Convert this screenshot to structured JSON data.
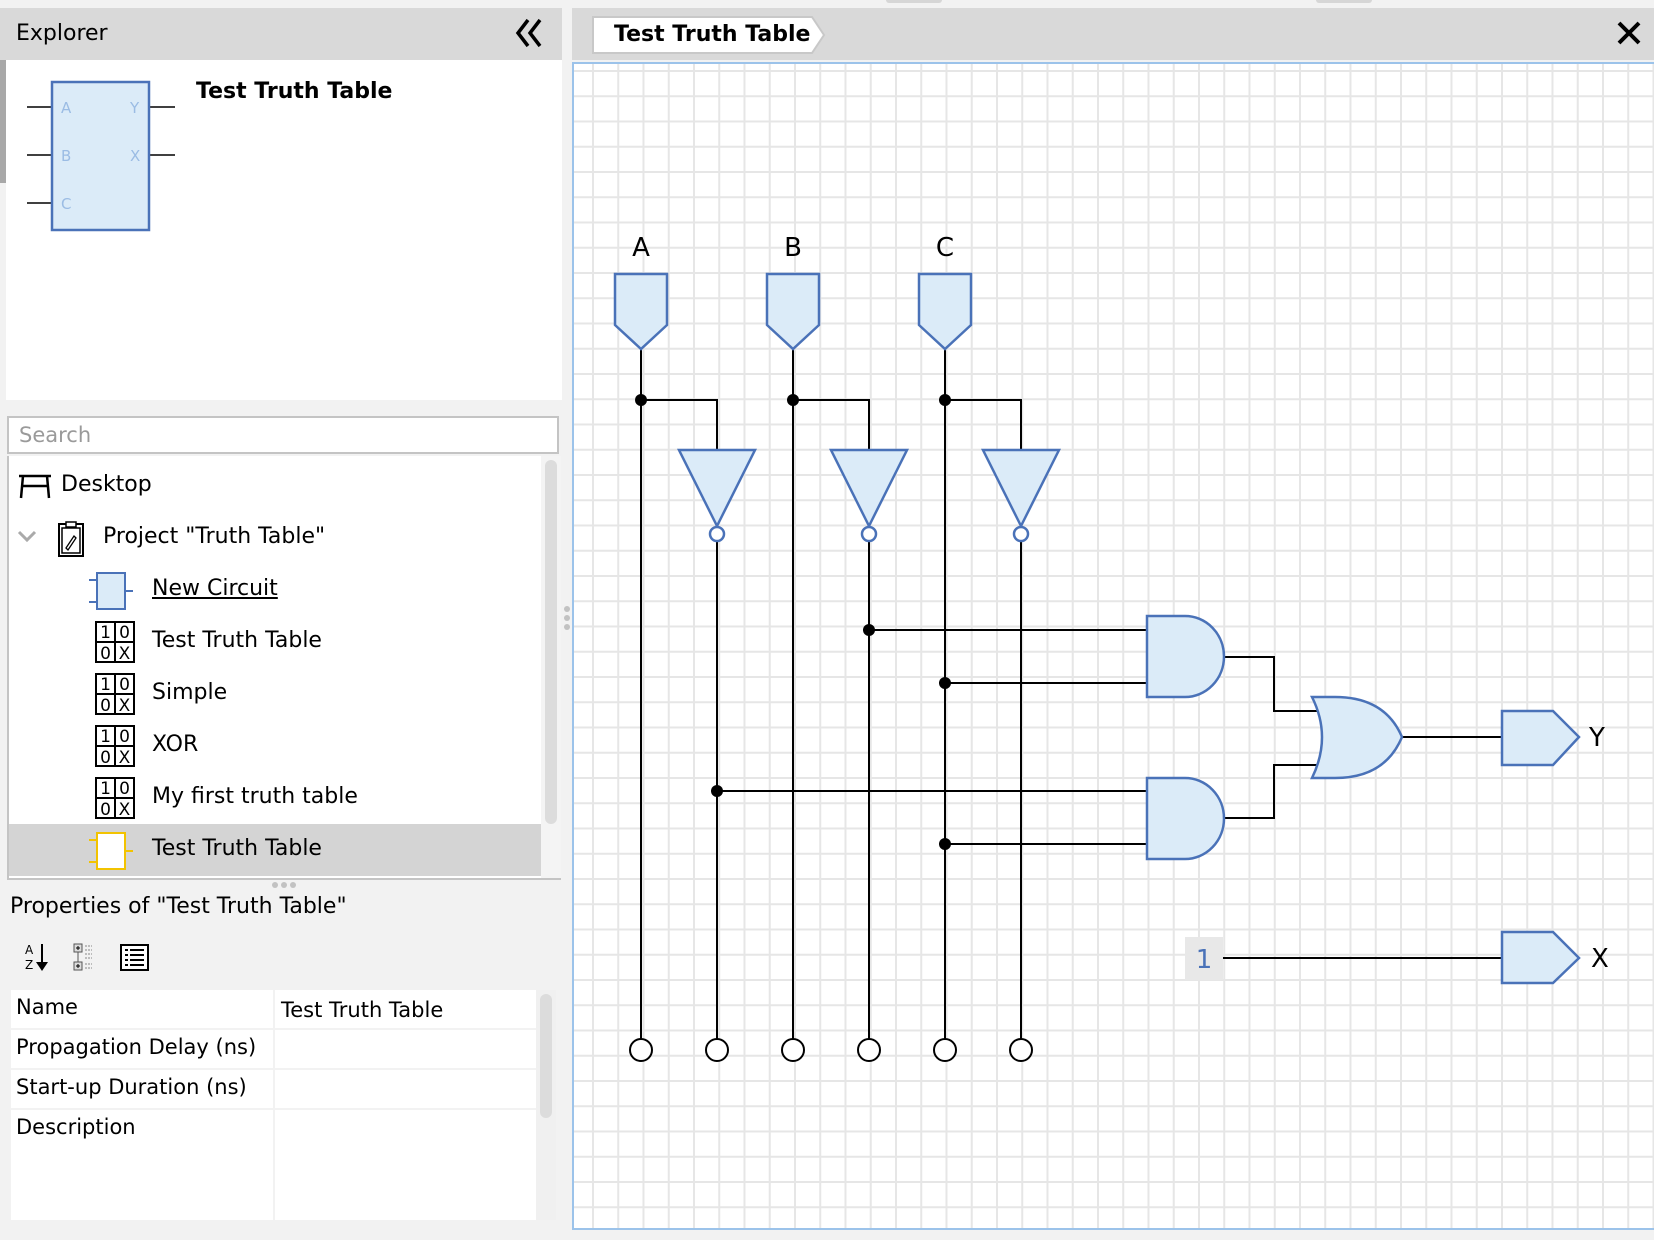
{
  "explorer": {
    "title": "Explorer",
    "collapse_icon": "double-chevron-left-icon",
    "preview": {
      "name": "Test Truth Table",
      "inputs": [
        "A",
        "B",
        "C"
      ],
      "outputs": [
        "Y",
        "X"
      ]
    },
    "search": {
      "placeholder": "Search",
      "value": ""
    },
    "tree": [
      {
        "label": "Desktop",
        "icon": "desktop-icon",
        "indent": 0
      },
      {
        "label": "Project \"Truth Table\"",
        "icon": "project-clipboard-icon",
        "indent": 1,
        "expanded": true
      },
      {
        "label": "New Circuit",
        "icon": "circuit-icon",
        "indent": 2,
        "underlined": true
      },
      {
        "label": "Test Truth Table",
        "icon": "truth-table-icon",
        "indent": 2
      },
      {
        "label": "Simple",
        "icon": "truth-table-icon",
        "indent": 2
      },
      {
        "label": "XOR",
        "icon": "truth-table-icon",
        "indent": 2
      },
      {
        "label": "My first truth table",
        "icon": "truth-table-icon",
        "indent": 2
      },
      {
        "label": "Test Truth Table",
        "icon": "circuit-selected-icon",
        "indent": 2,
        "selected": true
      }
    ],
    "truth_table_icon_cells": [
      "1",
      "0",
      "0",
      "X"
    ]
  },
  "properties": {
    "title": "Properties of \"Test Truth Table\"",
    "tools": [
      "sort-alphabetical-icon",
      "categorized-icon",
      "description-toggle-icon"
    ],
    "rows": [
      {
        "key": "Name",
        "value": "Test Truth Table"
      },
      {
        "key": "Propagation Delay (ns)",
        "value": ""
      },
      {
        "key": "Start-up Duration (ns)",
        "value": ""
      },
      {
        "key": "Description",
        "value": ""
      }
    ]
  },
  "editor": {
    "tab_label": "Test Truth Table",
    "close_icon": "close-icon",
    "circuit": {
      "inputs": [
        "A",
        "B",
        "C"
      ],
      "outputs": [
        "Y",
        "X"
      ],
      "constant_value": "1",
      "gates": [
        "NOT A",
        "NOT B",
        "NOT C",
        "AND(NOT B, C)",
        "AND(NOT A, C)",
        "OR",
        "Y",
        "X = 1"
      ],
      "probes": [
        "A",
        "NOT A",
        "B",
        "NOT B",
        "C",
        "NOT C"
      ]
    }
  },
  "colors": {
    "gate_fill": "#dbebf8",
    "gate_stroke": "#4a72b8",
    "wire": "#000000",
    "selection_highlight": "#f2c300",
    "canvas_border": "#9cc3ea"
  }
}
